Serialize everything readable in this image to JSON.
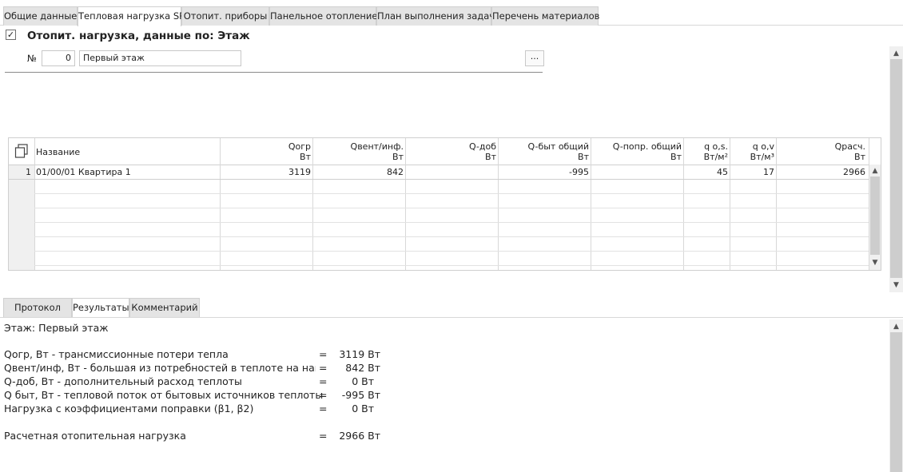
{
  "tabs": [
    {
      "label": "Общие данные",
      "active": false
    },
    {
      "label": "Тепловая нагрузка SP",
      "active": true
    },
    {
      "label": "Отопит. приборы",
      "active": false
    },
    {
      "label": "Панельное отопление",
      "active": false
    },
    {
      "label": "План выполнения задач",
      "active": false
    },
    {
      "label": "Перечень материалов",
      "active": false
    }
  ],
  "header": {
    "checkbox_checked": true,
    "checkbox_glyph": "✓",
    "title": "Отопит. нагрузка, данные по: Этаж",
    "number_label": "№",
    "number_value": "0",
    "name_value": "Первый этаж",
    "more_button": "..."
  },
  "table": {
    "columns": [
      {
        "name": "Название",
        "unit": ""
      },
      {
        "name": "Qогр",
        "unit": "Вт"
      },
      {
        "name": "Qвент/инф.",
        "unit": "Вт"
      },
      {
        "name": "Q-доб",
        "unit": "Вт"
      },
      {
        "name": "Q-быт общий",
        "unit": "Вт"
      },
      {
        "name": "Q-попр. общий",
        "unit": "Вт"
      },
      {
        "name": "q o,s.",
        "unit": "Вт/м²"
      },
      {
        "name": "q o,v",
        "unit": "Вт/м³"
      },
      {
        "name": "Qрасч.",
        "unit": "Вт"
      }
    ],
    "rows": [
      {
        "num": "1",
        "name": "01/00/01 Квартира 1",
        "qogr": "3119",
        "qvent": "842",
        "qdob": "",
        "qbyt": "-995",
        "qpopr": "",
        "qos": "45",
        "qov": "17",
        "qrasch": "2966"
      }
    ]
  },
  "bottom_tabs": [
    {
      "label": "Протокол",
      "active": false
    },
    {
      "label": "Результаты",
      "active": true
    },
    {
      "label": "Комментарий",
      "active": false
    }
  ],
  "results": {
    "heading": "Этаж: Первый этаж",
    "lines": [
      {
        "label": "Qогр, Вт - трансмиссионные потери тепла",
        "eq": "=",
        "value": "3119 Вт"
      },
      {
        "label": "Qвент/инф, Вт - большая из потребностей в теплоте на нагрев...",
        "eq": "=",
        "value": "842 Вт"
      },
      {
        "label": "Q-доб, Вт - дополнительный расход теплоты",
        "eq": "=",
        "value": "0 Вт"
      },
      {
        "label": "Q быт, Вт - тепловой поток от бытовых источников теплоты",
        "eq": "=",
        "value": "-995 Вт"
      },
      {
        "label": "Нагрузка с коэффициентами поправки (β1, β2)",
        "eq": "=",
        "value": "0 Вт"
      }
    ],
    "total": {
      "label": "Расчетная отопительная нагрузка",
      "eq": "=",
      "value": "2966 Вт"
    }
  }
}
